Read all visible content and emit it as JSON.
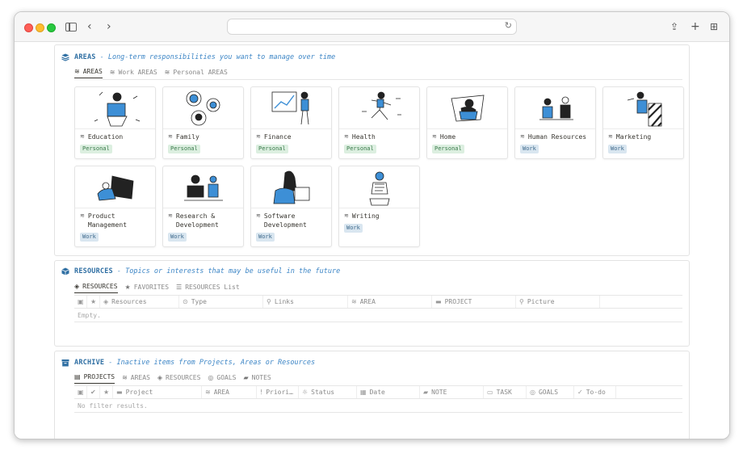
{
  "browser": {
    "url": ""
  },
  "areas": {
    "title": "AREAS",
    "description": "- Long-term responsibilities you want to manage over time",
    "tabs": [
      "AREAS",
      "Work AREAS",
      "Personal AREAS"
    ],
    "cards": [
      {
        "name": "Education",
        "tag": "Personal",
        "tag_type": "personal"
      },
      {
        "name": "Family",
        "tag": "Personal",
        "tag_type": "personal"
      },
      {
        "name": "Finance",
        "tag": "Personal",
        "tag_type": "personal"
      },
      {
        "name": "Health",
        "tag": "Personal",
        "tag_type": "personal"
      },
      {
        "name": "Home",
        "tag": "Personal",
        "tag_type": "personal"
      },
      {
        "name": "Human Resources",
        "tag": "Work",
        "tag_type": "work"
      },
      {
        "name": "Marketing",
        "tag": "Work",
        "tag_type": "work"
      },
      {
        "name": "Product Management",
        "tag": "Work",
        "tag_type": "work"
      },
      {
        "name": "Research & Development",
        "tag": "Work",
        "tag_type": "work"
      },
      {
        "name": "Software Development",
        "tag": "Work",
        "tag_type": "work"
      },
      {
        "name": "Writing",
        "tag": "Work",
        "tag_type": "work"
      }
    ]
  },
  "resources": {
    "title": "RESOURCES",
    "description": "- Topics or interests that may be useful in the future",
    "tabs": [
      "RESOURCES",
      "FAVORITES",
      "RESOURCES List"
    ],
    "columns": [
      "",
      "",
      "Resources",
      "Type",
      "Links",
      "AREA",
      "PROJECT",
      "Picture"
    ],
    "empty_text": "Empty."
  },
  "archive": {
    "title": "ARCHIVE",
    "description": "- Inactive items from Projects, Areas or Resources",
    "tabs": [
      "PROJECTS",
      "AREAS",
      "RESOURCES",
      "GOALS",
      "NOTES"
    ],
    "columns": [
      "",
      "",
      "",
      "Project",
      "AREA",
      "Priori…",
      "Status",
      "Date",
      "NOTE",
      "TASK",
      "GOALS",
      "To-do"
    ],
    "empty_text": "No filter results."
  },
  "colors": {
    "accent": "#2f6fa3",
    "illustration_blue": "#3d8fd6",
    "personal_tag": "#dcefe0",
    "work_tag": "#d9e6f0"
  }
}
